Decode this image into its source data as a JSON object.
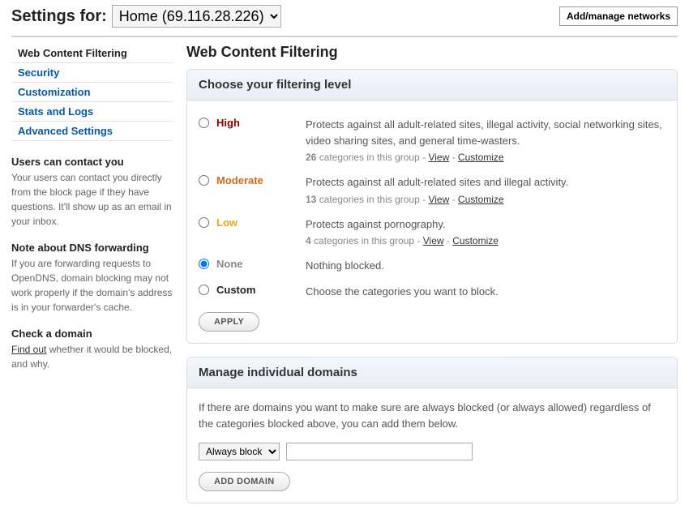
{
  "header": {
    "settings_for_label": "Settings for:",
    "network_name": "Home (69.116.28.226)",
    "add_networks_label": "Add/manage networks"
  },
  "sidebar": {
    "nav": [
      {
        "label": "Web Content Filtering",
        "active": true
      },
      {
        "label": "Security",
        "active": false
      },
      {
        "label": "Customization",
        "active": false
      },
      {
        "label": "Stats and Logs",
        "active": false
      },
      {
        "label": "Advanced Settings",
        "active": false
      }
    ],
    "sections": {
      "contact": {
        "title": "Users can contact you",
        "body": "Your users can contact you directly from the block page if they have questions. It'll show up as an email in your inbox."
      },
      "dns": {
        "title": "Note about DNS forwarding",
        "body": "If you are forwarding requests to OpenDNS, domain blocking may not work properly if the domain's address is in your forwarder's cache."
      },
      "check": {
        "title": "Check a domain",
        "link": "Find out",
        "body_after": " whether it would be blocked, and why."
      }
    }
  },
  "main": {
    "page_title": "Web Content Filtering",
    "filtering_panel": {
      "heading": "Choose your filtering level",
      "levels": {
        "high": {
          "name": "High",
          "desc": "Protects against all adult-related sites, illegal activity, social networking sites, video sharing sites, and general time-wasters.",
          "count": "26",
          "count_text": " categories in this group - ",
          "view": "View",
          "sep": " - ",
          "customize": "Customize"
        },
        "moderate": {
          "name": "Moderate",
          "desc": "Protects against all adult-related sites and illegal activity.",
          "count": "13",
          "count_text": " categories in this group - ",
          "view": "View",
          "sep": " - ",
          "customize": "Customize"
        },
        "low": {
          "name": "Low",
          "desc": "Protects against pornography.",
          "count": "4",
          "count_text": " categories in this group - ",
          "view": "View",
          "sep": " - ",
          "customize": "Customize"
        },
        "none": {
          "name": "None",
          "desc": "Nothing blocked."
        },
        "custom": {
          "name": "Custom",
          "desc": "Choose the categories you want to block."
        }
      },
      "apply_label": "APPLY"
    },
    "domains_panel": {
      "heading": "Manage individual domains",
      "body": "If there are domains you want to make sure are always blocked (or always allowed) regardless of the categories blocked above, you can add them below.",
      "select_value": "Always block",
      "input_value": "",
      "add_label": "ADD DOMAIN"
    }
  }
}
